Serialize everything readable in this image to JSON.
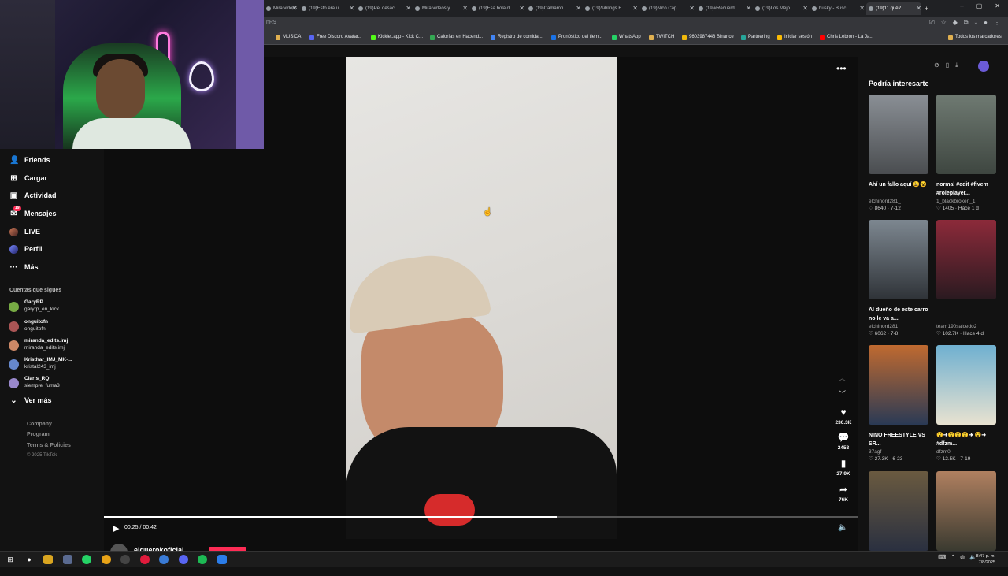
{
  "browser": {
    "tabs": [
      {
        "label": "Mira videos g",
        "active": false
      },
      {
        "label": "(19)Esto era u",
        "active": false
      },
      {
        "label": "(19)Pel desac",
        "active": false
      },
      {
        "label": "Mira videos y",
        "active": false
      },
      {
        "label": "(19)Esa bola d",
        "active": false
      },
      {
        "label": "(19)Camaron",
        "active": false
      },
      {
        "label": "(19)Siblings F",
        "active": false
      },
      {
        "label": "(19)Nico Cap",
        "active": false
      },
      {
        "label": "(19)#Recuerd",
        "active": false
      },
      {
        "label": "(19)Los Mejo",
        "active": false
      },
      {
        "label": "husky - Busc",
        "active": false
      },
      {
        "label": "(19)11 qué?",
        "active": true
      }
    ],
    "new_tab": "+",
    "url_fragment": "nR9",
    "bookmarks": [
      {
        "label": "MUSICA",
        "color": "#e0b050"
      },
      {
        "label": "Free Discord Avatar...",
        "color": "#5865f2"
      },
      {
        "label": "Kicklet.app - Kick C...",
        "color": "#53fc18"
      },
      {
        "label": "Calorías en Hacend...",
        "color": "#34a853"
      },
      {
        "label": "Registro de comida...",
        "color": "#4285f4"
      },
      {
        "label": "Pronóstico del tiem...",
        "color": "#1a73e8"
      },
      {
        "label": "WhatsApp",
        "color": "#25d366"
      },
      {
        "label": "TWITCH",
        "color": "#e0b050"
      },
      {
        "label": "9603987448 Binance",
        "color": "#f0b90b"
      },
      {
        "label": "Partnering",
        "color": "#26a69a"
      },
      {
        "label": "Iniciar sesión",
        "color": "#fbbc04"
      },
      {
        "label": "Chris Lebron - La Ja...",
        "color": "#ff0000"
      },
      {
        "label": "Todos los marcadores",
        "color": "#e0b050"
      }
    ]
  },
  "nav": {
    "items": [
      {
        "label": "Friends",
        "icon": "friends-icon",
        "glyph": "👤"
      },
      {
        "label": "Cargar",
        "icon": "upload-icon",
        "glyph": "⊞"
      },
      {
        "label": "Actividad",
        "icon": "activity-icon",
        "glyph": "▣"
      },
      {
        "label": "Mensajes",
        "icon": "messages-icon",
        "glyph": "✉"
      },
      {
        "label": "LIVE",
        "icon": "live-icon",
        "glyph": ""
      },
      {
        "label": "Perfil",
        "icon": "profile-icon",
        "glyph": ""
      },
      {
        "label": "Más",
        "icon": "more-icon",
        "glyph": "···"
      }
    ],
    "messages_badge": "19",
    "following_title": "Cuentas que sigues",
    "following": [
      {
        "name": "GaryRP",
        "user": "garyrp_en_kick",
        "color": "#7a4"
      },
      {
        "name": "onguitofn",
        "user": "onguitofn",
        "color": "#a55"
      },
      {
        "name": "miranda_edits.imj",
        "user": "miranda_edits.imj",
        "color": "#c86"
      },
      {
        "name": "Kristhar_IMJ_MK-...",
        "user": "kristal243_imj",
        "color": "#68c"
      },
      {
        "name": "Claris_RQ",
        "user": "siempre_fuma3",
        "color": "#98c"
      }
    ],
    "see_more": "Ver más",
    "footer": [
      "Company",
      "Program",
      "Terms & Policies"
    ],
    "copyright": "© 2025 TikTok"
  },
  "player": {
    "likes": "230.3K",
    "comments": "2453",
    "saves": "27.9K",
    "shares": "76K",
    "time": "00:25 / 00:42",
    "progress": 0.6,
    "author": "elguerokoficial"
  },
  "right_panel": {
    "title": "Podría interesarte",
    "cards": [
      {
        "title": "Ahí un fallo aquí 😩😮",
        "user": "elchinord281_",
        "stats": "♡ 8640 · 7-12",
        "c1": "#8a8f95",
        "c2": "#4a4d50"
      },
      {
        "title": "normal #edit #fivem #roleplayer...",
        "user": "1_blackbroken_1",
        "stats": "♡ 1405 · Hace 1 d",
        "c1": "#6f7a72",
        "c2": "#3e4640"
      },
      {
        "title": "Al dueño de este carro no le va a...",
        "user": "elchinord281_",
        "stats": "♡ 6062 · 7-8",
        "c1": "#7d8790",
        "c2": "#2f3338"
      },
      {
        "title": "",
        "user": "team190salcedo2",
        "stats": "♡ 102.7K · Hace 4 d",
        "c1": "#8c2a3a",
        "c2": "#2a1a20"
      },
      {
        "title": "NINO FREESTYLE VS SR...",
        "user": "37agf",
        "stats": "♡ 27.3K · 6-23",
        "c1": "#c06a30",
        "c2": "#2a3a55"
      },
      {
        "title": "😮➜😮😮😮➜ 😮➜ #dfzm...",
        "user": "dfzm0",
        "stats": "♡ 12.5K · 7-19",
        "c1": "#6fb0d0",
        "c2": "#e8e2d0"
      },
      {
        "title": "",
        "user": "",
        "stats": "",
        "c1": "#6a5a40",
        "c2": "#2a3040"
      },
      {
        "title": "",
        "user": "",
        "stats": "",
        "c1": "#b08060",
        "c2": "#3a3a30"
      }
    ]
  },
  "taskbar": {
    "clock_time": "8:47 p. m.",
    "clock_date": "7/8/2025"
  }
}
